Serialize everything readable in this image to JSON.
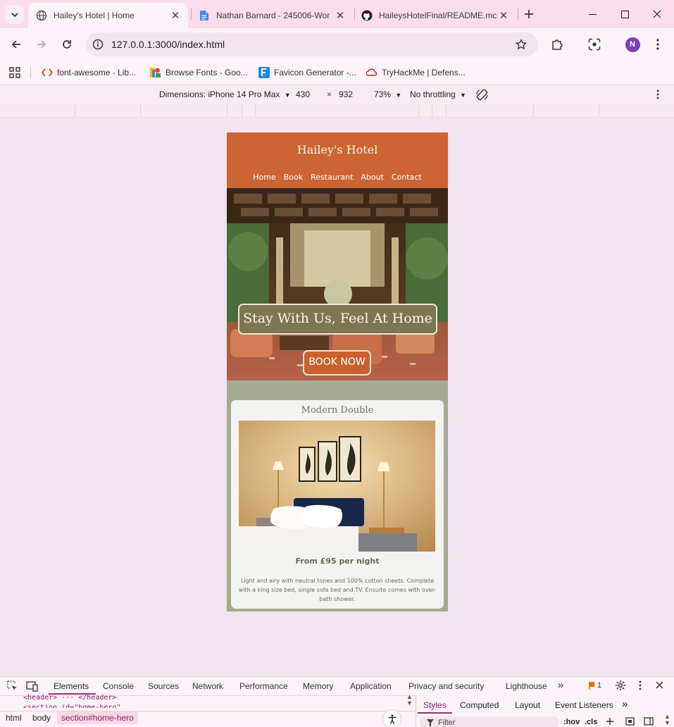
{
  "browser": {
    "tabs": [
      {
        "title": "Hailey's Hotel | Home",
        "icon": "globe-icon"
      },
      {
        "title": "Nathan Barnard - 245006-Wor",
        "icon": "google-docs-icon"
      },
      {
        "title": "HaileysHotelFinal/README.mc",
        "icon": "github-icon"
      }
    ],
    "url": "127.0.0.1:3000/index.html",
    "profile_initial": "N",
    "bookmarks": [
      {
        "label": "font-awesome - Lib...",
        "icon": "code-icon"
      },
      {
        "label": "Browse Fonts - Goo...",
        "icon": "google-fonts-icon"
      },
      {
        "label": "Favicon Generator -...",
        "icon": "favicon-generator-icon"
      },
      {
        "label": "TryHackMe | Defens...",
        "icon": "tryhackme-icon"
      }
    ]
  },
  "device_toolbar": {
    "dimensions_label": "Dimensions: iPhone 14 Pro Max",
    "width": "430",
    "times": "×",
    "height": "932",
    "zoom": "73%",
    "throttling": "No throttling"
  },
  "site": {
    "title": "Hailey's Hotel",
    "nav": [
      "Home",
      "Book",
      "Restaurant",
      "About",
      "Contact"
    ],
    "hero_heading": "Stay With Us, Feel At Home",
    "hero_button": "BOOK NOW",
    "room": {
      "name": "Modern Double",
      "price": "From £95 per night",
      "description": "Light and airy with neutral tones and 100% cotton sheets. Complete with a king size bed, single sofa bed and TV. Ensuite comes with over-bath shower."
    },
    "colors": {
      "header": "#cc6433",
      "accent": "#7b7753",
      "background": "#a6aa94"
    }
  },
  "devtools": {
    "tabs": [
      "Elements",
      "Console",
      "Sources",
      "Network",
      "Performance",
      "Memory",
      "Application",
      "Privacy and security",
      "Lighthouse"
    ],
    "more": "»",
    "issues_count": "1",
    "dom_line_1": "<header> ··· </header>",
    "dom_line_2": "<section id=\"home-hero\"",
    "breadcrumbs": [
      "html",
      "body",
      "section#home-hero"
    ],
    "side_tabs": [
      "Styles",
      "Computed",
      "Layout",
      "Event Listeners"
    ],
    "filter_placeholder": "Filter",
    "hov": ":hov",
    "cls": ".cls"
  }
}
